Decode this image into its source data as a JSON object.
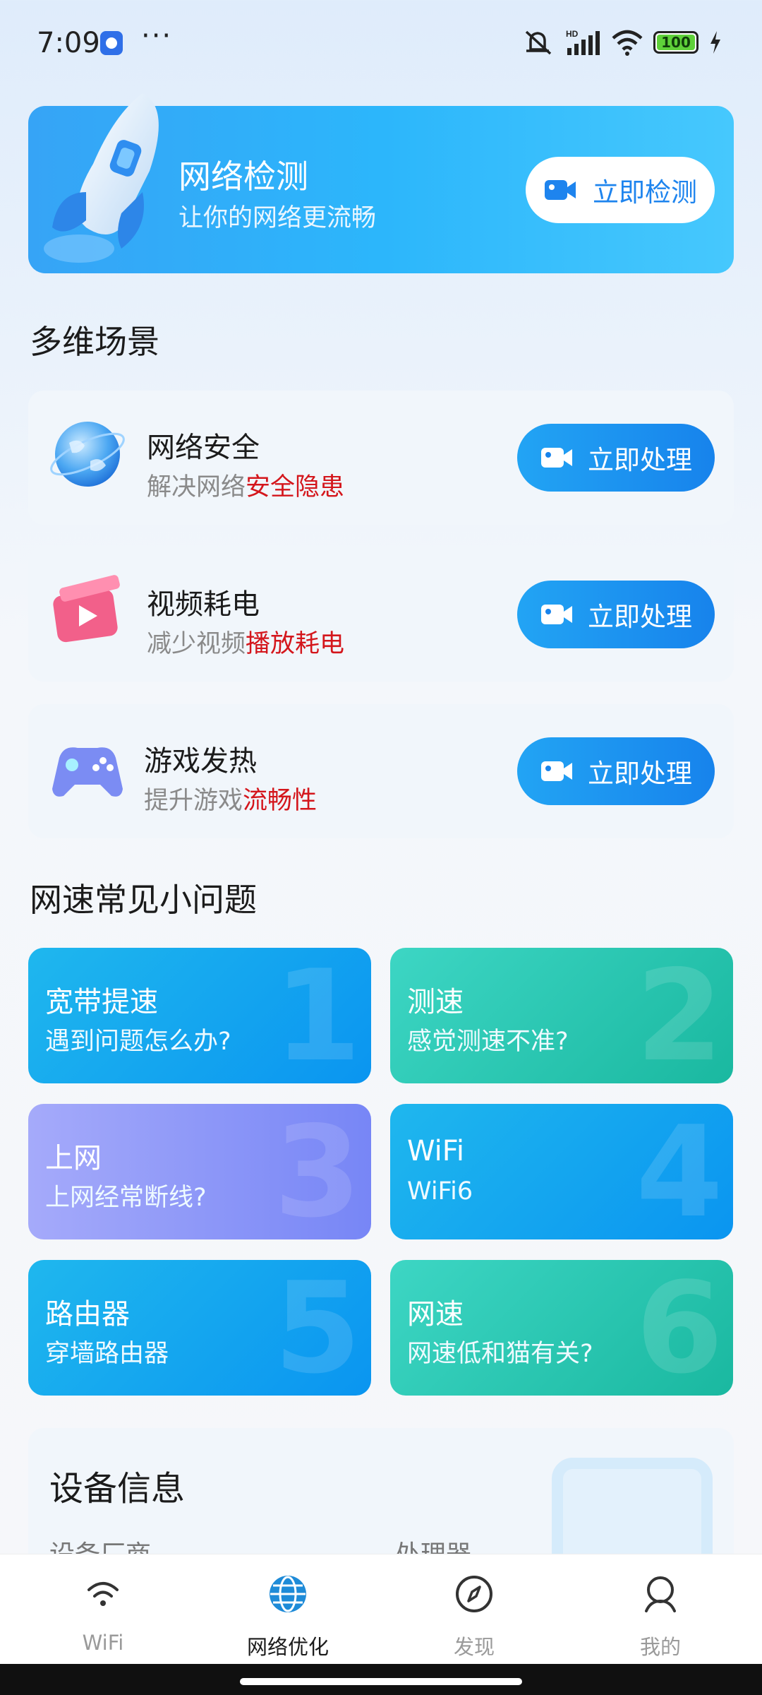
{
  "status": {
    "time": "7:09",
    "battery": "100"
  },
  "hero": {
    "title": "网络检测",
    "subtitle": "让你的网络更流畅",
    "button_label": "立即检测"
  },
  "scenes": {
    "title": "多维场景",
    "items": [
      {
        "title": "网络安全",
        "desc_prefix": "解决网络",
        "desc_highlight": "安全隐患",
        "button_label": "立即处理"
      },
      {
        "title": "视频耗电",
        "desc_prefix": "减少视频",
        "desc_highlight": "播放耗电",
        "button_label": "立即处理"
      },
      {
        "title": "游戏发热",
        "desc_prefix": "提升游戏",
        "desc_highlight": "流畅性",
        "button_label": "立即处理"
      }
    ]
  },
  "faq": {
    "title": "网速常见小问题",
    "tiles": [
      {
        "num": "1",
        "title": "宽带提速",
        "subtitle": "遇到问题怎么办?"
      },
      {
        "num": "2",
        "title": "测速",
        "subtitle": "感觉测速不准?"
      },
      {
        "num": "3",
        "title": "上网",
        "subtitle": "上网经常断线?"
      },
      {
        "num": "4",
        "title": "WiFi",
        "subtitle": "WiFi6"
      },
      {
        "num": "5",
        "title": "路由器",
        "subtitle": "穿墙路由器"
      },
      {
        "num": "6",
        "title": "网速",
        "subtitle": "网速低和猫有关?"
      }
    ]
  },
  "device": {
    "title": "设备信息",
    "label_vendor": "设备厂商",
    "label_cpu": "处理器"
  },
  "nav": {
    "items": [
      {
        "label": "WiFi",
        "icon": "wifi-icon"
      },
      {
        "label": "网络优化",
        "icon": "globe-icon"
      },
      {
        "label": "发现",
        "icon": "compass-icon"
      },
      {
        "label": "我的",
        "icon": "profile-icon"
      }
    ],
    "active_index": 1
  },
  "colors": {
    "accent": "#1e84ee",
    "highlight_red": "#d4161c",
    "tile_blue": "#0a95f0",
    "tile_teal": "#1ab8a0",
    "tile_violet": "#7786f6"
  }
}
